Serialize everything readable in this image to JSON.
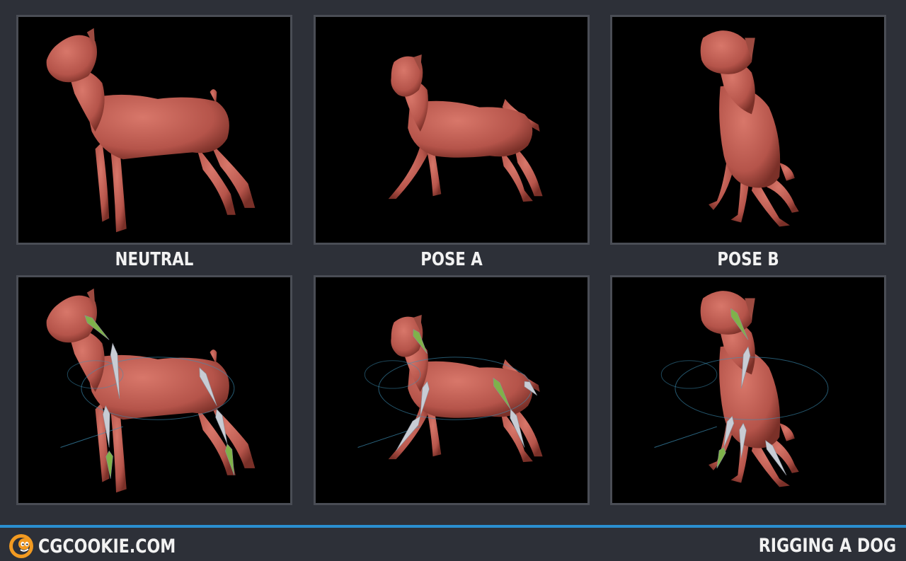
{
  "panels": [
    {
      "label": "NEUTRAL",
      "rigged": false,
      "pose": "neutral"
    },
    {
      "label": "POSE A",
      "rigged": false,
      "pose": "walk"
    },
    {
      "label": "POSE B",
      "rigged": false,
      "pose": "sit"
    },
    {
      "label": "",
      "rigged": true,
      "pose": "neutral"
    },
    {
      "label": "",
      "rigged": true,
      "pose": "walk"
    },
    {
      "label": "",
      "rigged": true,
      "pose": "sit"
    }
  ],
  "footer": {
    "brand": "CGCOOKIE.COM",
    "title": "RIGGING A DOG",
    "accent_color": "#2a8fd0"
  },
  "colors": {
    "dog_skin": "#b5544a",
    "bone": "#c8ccd4",
    "bone_green": "#7fb24a",
    "controller": "#3c8fb5"
  }
}
